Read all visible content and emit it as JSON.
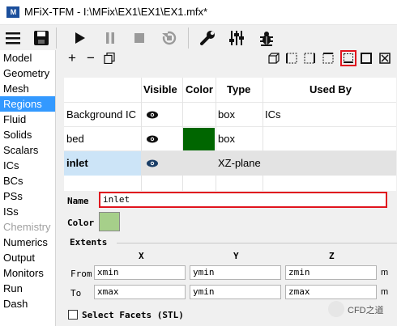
{
  "window": {
    "title": "MFiX-TFM - I:\\MFix\\EX1\\EX1\\EX1.mfx*",
    "logo_text": "M"
  },
  "toolbar": {
    "icons": [
      "menu-icon",
      "save-icon",
      "run-icon",
      "pause-icon",
      "stop-icon",
      "reset-icon",
      "settings-wrench-icon",
      "parameters-sliders-icon",
      "debug-bug-icon"
    ]
  },
  "sidebar": {
    "items": [
      {
        "label": "Model"
      },
      {
        "label": "Geometry"
      },
      {
        "label": "Mesh"
      },
      {
        "label": "Regions"
      },
      {
        "label": "Fluid"
      },
      {
        "label": "Solids"
      },
      {
        "label": "Scalars"
      },
      {
        "label": "ICs"
      },
      {
        "label": "BCs"
      },
      {
        "label": "PSs"
      },
      {
        "label": "ISs"
      },
      {
        "label": "Chemistry"
      },
      {
        "label": "Numerics"
      },
      {
        "label": "Output"
      },
      {
        "label": "Monitors"
      },
      {
        "label": "Run"
      },
      {
        "label": "Dash"
      }
    ],
    "selected": "Regions",
    "disabled": "Chemistry"
  },
  "region_toolbar": {
    "add": "+",
    "remove": "−",
    "view_buttons": [
      "cube-view-icon",
      "xy-plane-icon",
      "xz-plane-icon",
      "yz-plane-icon",
      "stl-icon",
      "box-icon",
      "clear-icon"
    ]
  },
  "table": {
    "headers": [
      "Visible",
      "Color",
      "Type",
      "Used By"
    ],
    "rows": [
      {
        "name": "Background IC",
        "type": "box",
        "used_by": "ICs",
        "color": ""
      },
      {
        "name": "bed",
        "type": "box",
        "used_by": "",
        "color": "#006600"
      },
      {
        "name": "inlet",
        "type": "XZ-plane",
        "used_by": "",
        "color": ""
      }
    ],
    "selected_row": "inlet"
  },
  "panel": {
    "name_label": "Name",
    "name_value": "inlet",
    "color_label": "Color",
    "color_value": "#a6cf8a",
    "extents_label": "Extents",
    "axis_headers": [
      "X",
      "Y",
      "Z"
    ],
    "from_label": "From",
    "to_label": "To",
    "from_values": [
      "xmin",
      "ymin",
      "zmin"
    ],
    "to_values": [
      "xmax",
      "ymin",
      "zmax"
    ],
    "unit": "m",
    "select_facets_label": "Select Facets (STL)"
  },
  "watermark": "CFD之道"
}
